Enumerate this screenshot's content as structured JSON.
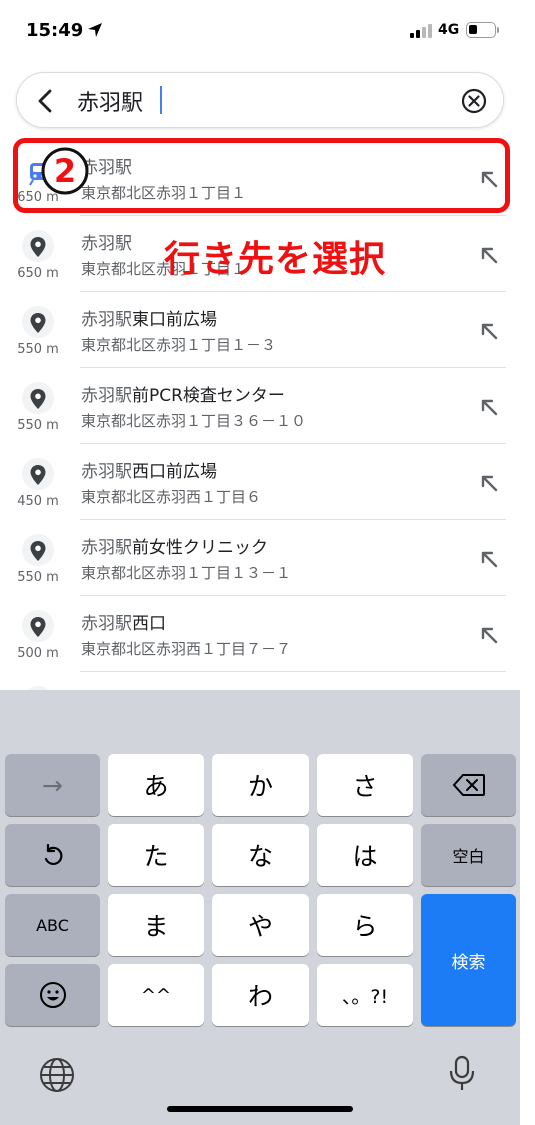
{
  "status_bar": {
    "time": "15:49",
    "network": "4G",
    "battery_level": 0.2
  },
  "search": {
    "query": "赤羽駅"
  },
  "results": [
    {
      "title_matched": "赤羽駅",
      "title_rest": "",
      "address": "東京都北区赤羽１丁目１",
      "distance": "650 m",
      "icon": "train-icon"
    },
    {
      "title_matched": "赤羽駅",
      "title_rest": "",
      "address": "東京都北区赤羽１丁目１",
      "distance": "650 m",
      "icon": "map-pin-icon"
    },
    {
      "title_matched": "赤羽駅",
      "title_rest": "東口前広場",
      "address": "東京都北区赤羽１丁目１－３",
      "distance": "550 m",
      "icon": "map-pin-icon"
    },
    {
      "title_matched": "赤羽駅",
      "title_rest": "前PCR検査センター",
      "address": "東京都北区赤羽１丁目３６－１０",
      "distance": "550 m",
      "icon": "map-pin-icon"
    },
    {
      "title_matched": "赤羽駅",
      "title_rest": "西口前広場",
      "address": "東京都北区赤羽西１丁目６",
      "distance": "450 m",
      "icon": "map-pin-icon"
    },
    {
      "title_matched": "赤羽駅",
      "title_rest": "前女性クリニック",
      "address": "東京都北区赤羽１丁目１３－１",
      "distance": "550 m",
      "icon": "map-pin-icon"
    },
    {
      "title_matched": "赤羽駅",
      "title_rest": "西口",
      "address": "東京都北区赤羽西１丁目７－７",
      "distance": "500 m",
      "icon": "map-pin-icon"
    }
  ],
  "annotation": {
    "step_number": "2",
    "callout_text": "行き先を選択",
    "color": "#ee1111"
  },
  "keyboard": {
    "row1": [
      "→",
      "あ",
      "か",
      "さ",
      "⌫"
    ],
    "row2": [
      "↺",
      "た",
      "な",
      "は",
      "空白"
    ],
    "row3": [
      "ABC",
      "ま",
      "や",
      "ら",
      "検索"
    ],
    "row4": [
      "☺",
      "^^",
      "わ",
      "、。?!"
    ],
    "accent_color": "#1c7cf5"
  }
}
